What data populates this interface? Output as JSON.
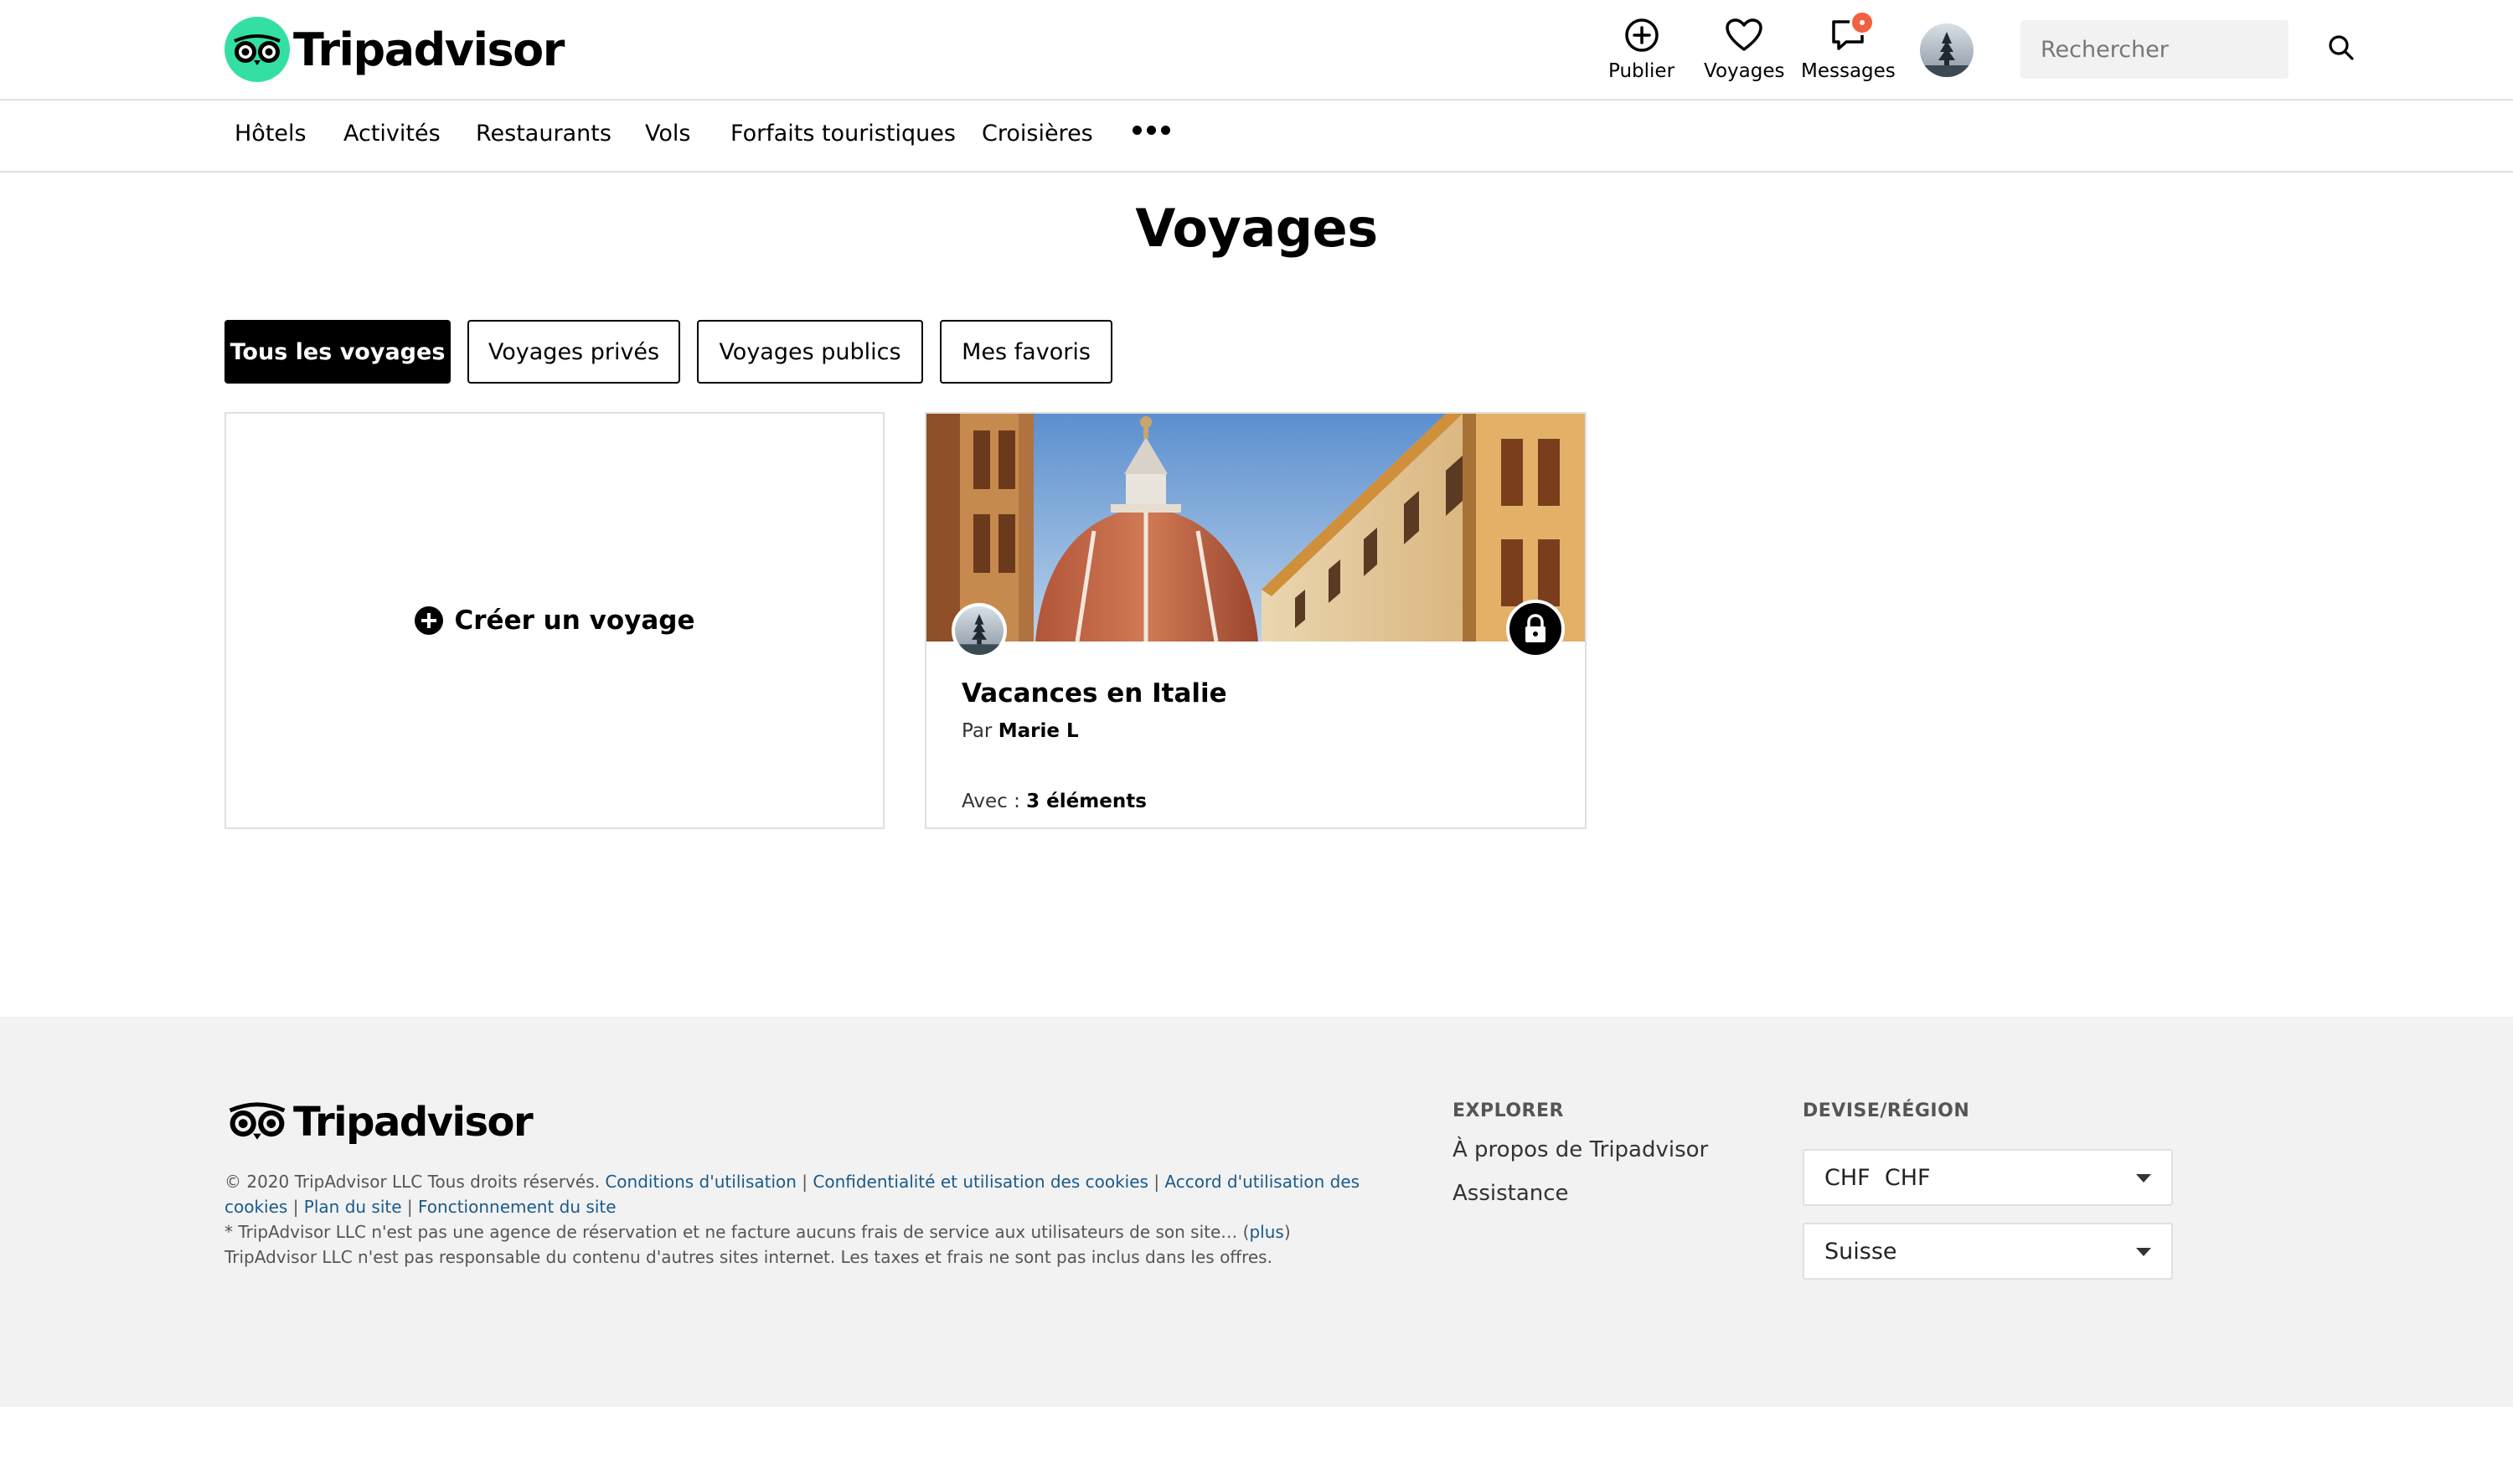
{
  "header": {
    "logo_text": "Tripadvisor",
    "publish_label": "Publier",
    "trips_label": "Voyages",
    "messages_label": "Messages",
    "search_placeholder": "Rechercher"
  },
  "nav": {
    "items": [
      "Hôtels",
      "Activités",
      "Restaurants",
      "Vols",
      "Forfaits touristiques",
      "Croisières"
    ]
  },
  "main": {
    "title": "Voyages",
    "tabs": [
      {
        "label": "Tous les voyages",
        "active": true
      },
      {
        "label": "Voyages privés",
        "active": false
      },
      {
        "label": "Voyages publics",
        "active": false
      },
      {
        "label": "Mes favoris",
        "active": false
      }
    ],
    "create_label": "Créer un voyage",
    "trip": {
      "title": "Vacances en Italie",
      "by_prefix": "Par",
      "author": "Marie L",
      "items_prefix": "Avec :",
      "items_count": "3 éléments"
    }
  },
  "footer": {
    "logo_text": "Tripadvisor",
    "copyright": "© 2020 TripAdvisor LLC Tous droits réservés.",
    "links": [
      "Conditions d'utilisation",
      "Confidentialité et utilisation des cookies",
      "Accord d'utilisation des cookies",
      "Plan du site",
      "Fonctionnement du site"
    ],
    "disclaimer1": "* TripAdvisor LLC n'est pas une agence de réservation et ne facture aucuns frais de service aux utilisateurs de son site… (",
    "more_link": "plus",
    "disclaimer1_end": ")",
    "disclaimer2": "TripAdvisor LLC n'est pas responsable du contenu d'autres sites internet. Les taxes et frais ne sont pas inclus dans les offres.",
    "explore_title": "EXPLORER",
    "explore_links": [
      "À propos de Tripadvisor",
      "Assistance"
    ],
    "currency_title": "DEVISE/RÉGION",
    "currency_value": "CHF  CHF",
    "region_value": "Suisse"
  },
  "colors": {
    "brand_green": "#34e0a1",
    "notification": "#f2603f",
    "footer_bg": "#f2f2f2",
    "link_blue": "#1a5a8a"
  }
}
